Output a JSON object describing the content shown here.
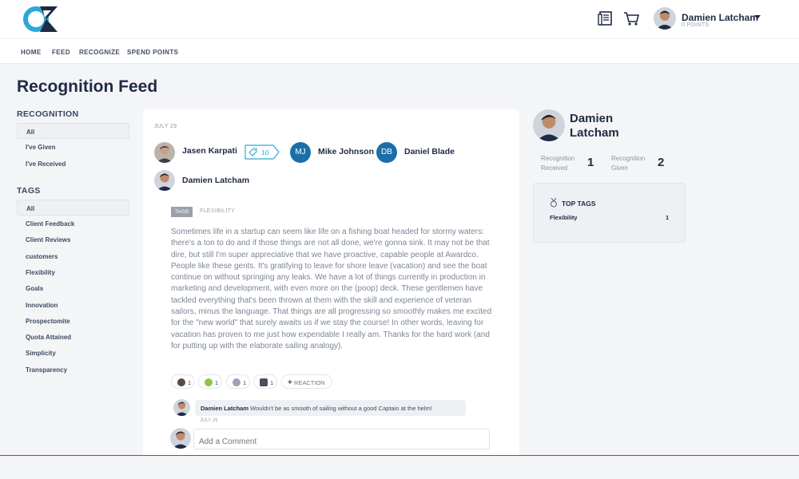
{
  "header": {
    "user": {
      "name": "Damien Latcham",
      "points": "0 POINTS"
    }
  },
  "nav": [
    "HOME",
    "FEED",
    "RECOGNIZE",
    "SPEND POINTS"
  ],
  "page_title": "Recognition Feed",
  "sidebar": {
    "recognition_heading": "RECOGNITION",
    "recognition_items": [
      "All",
      "I've Given",
      "I've Received"
    ],
    "tags_heading": "TAGS",
    "tag_items": [
      "All",
      "Client Feedback",
      "Client Reviews",
      "customers",
      "Flexibility",
      "Goals",
      "Innovation",
      "Prospectomite",
      "Quota Attained",
      "Simplicity",
      "Transparency"
    ]
  },
  "post": {
    "date": "JULY 29",
    "giver": "Jasen Karpati",
    "points": "10",
    "recipients": [
      {
        "initials": "MJ",
        "name": "Mike Johnson"
      },
      {
        "initials": "DB",
        "name": "Daniel Blade"
      },
      {
        "name": "Damien Latcham"
      }
    ],
    "tags_label": "TAGS",
    "tag": "FLEXIBILITY",
    "message": "Sometimes life in a startup can seem like life on a fishing boat headed for stormy waters: there's a ton to do and if those things are not all done, we're gonna sink. It may not be that dire, but still I'm super appreciative that we have proactive, capable people at Awardco. People like these gents. It's gratifying to leave for shore leave (vacation) and see the boat continue on without springing any leaks. We have a lot of things currently in production in marketing and development, with even more on the (poop) deck. These gentlemen have tackled everything that's been thrown at them with the skill and experience of veteran sailors, minus the language. That things are all progressing so smoothly makes me excited for the \"new world\" that surely awaits us if we stay the course! In other words, leaving for vacation has proven to me just how expendable I really am. Thanks for the hard work (and for putting up with the elaborate sailing analogy).",
    "reactions": [
      {
        "icon": "person-emoji-icon",
        "count": "1",
        "color": "#5b4a3f"
      },
      {
        "icon": "alien-emoji-icon",
        "count": "1",
        "color": "#8cc63f"
      },
      {
        "icon": "robot-emoji-icon",
        "count": "1",
        "color": "#9aa3b1"
      },
      {
        "icon": "sailboat-emoji-icon",
        "count": "1",
        "color": "#4a4f5a"
      }
    ],
    "add_reaction_label": "REACTION",
    "comment": {
      "author": "Damien Latcham",
      "text": "Wouldn't be as smooth of sailing without a good Captain at the helm!",
      "date": "JULY 29"
    },
    "comment_placeholder": "Add a Comment"
  },
  "profile": {
    "name": "Damien Latcham",
    "received_label_1": "Recognition",
    "received_label_2": "Received",
    "received_value": "1",
    "given_label_1": "Recognition",
    "given_label_2": "Given",
    "given_value": "2",
    "top_tags_title": "TOP TAGS",
    "top_tags": [
      {
        "name": "Flexibility",
        "count": "1"
      }
    ]
  },
  "colors": {
    "accent": "#2aa9d8",
    "brand": "#1f2a44",
    "initials_bg": "#1b6fa8"
  }
}
